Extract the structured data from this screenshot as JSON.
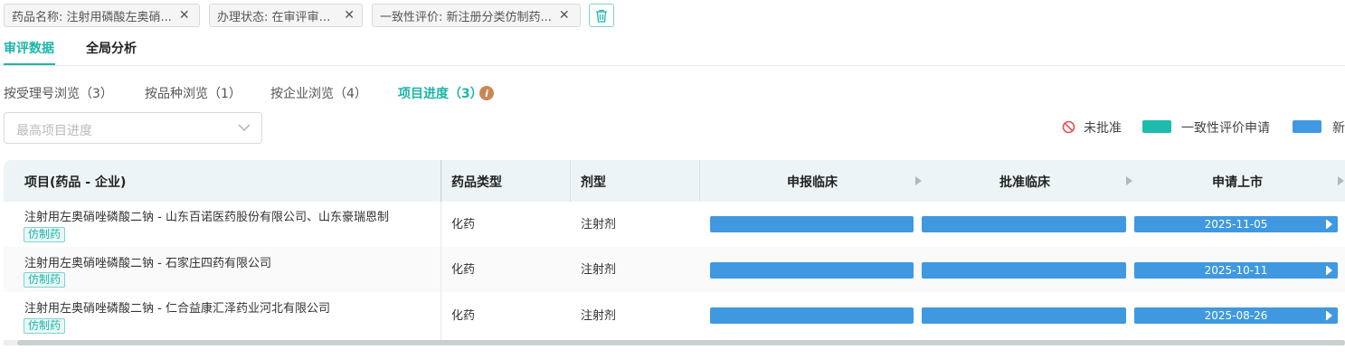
{
  "filters": [
    {
      "label": "药品名称: 注射用磷酸左奥硝..."
    },
    {
      "label": "办理状态: 在审评审批中"
    },
    {
      "label": "一致性评价: 新注册分类仿制药..."
    }
  ],
  "main_tabs": [
    {
      "label": "审评数据",
      "active": true
    },
    {
      "label": "全局分析",
      "active": false
    }
  ],
  "sub_tabs": [
    {
      "label": "按受理号浏览（3）",
      "active": false
    },
    {
      "label": "按品种浏览（1）",
      "active": false
    },
    {
      "label": "按企业浏览（4）",
      "active": false
    },
    {
      "label": "项目进度（3）",
      "active": true
    }
  ],
  "select": {
    "placeholder": "最高项目进度"
  },
  "legend": [
    {
      "label": "未批准",
      "icon": "ban-icon"
    },
    {
      "label": "一致性评价申请",
      "color": "#1fbcae"
    },
    {
      "label": "新",
      "color": "#4099e0"
    }
  ],
  "table": {
    "headers": {
      "project": "项目(药品 - 企业)",
      "drug_type": "药品类型",
      "form": "剂型",
      "phases": [
        "申报临床",
        "批准临床",
        "申请上市"
      ]
    },
    "rows": [
      {
        "name": "注射用左奥硝唑磷酸二钠 - 山东百诺医药股份有限公司、山东豪瑞恩制",
        "tag": "仿制药",
        "drug_type": "化药",
        "form": "注射剂",
        "date": "2025-11-05"
      },
      {
        "name": "注射用左奥硝唑磷酸二钠 - 石家庄四药有限公司",
        "tag": "仿制药",
        "drug_type": "化药",
        "form": "注射剂",
        "date": "2025-10-11"
      },
      {
        "name": "注射用左奥硝唑磷酸二钠 - 仁合益康汇泽药业河北有限公司",
        "tag": "仿制药",
        "drug_type": "化药",
        "form": "注射剂",
        "date": "2025-08-26"
      }
    ]
  },
  "colors": {
    "accent": "#1db5a8",
    "bar": "#4099e0",
    "consistency": "#1fbcae",
    "warning": "#c98756",
    "rejected": "#e05252"
  }
}
